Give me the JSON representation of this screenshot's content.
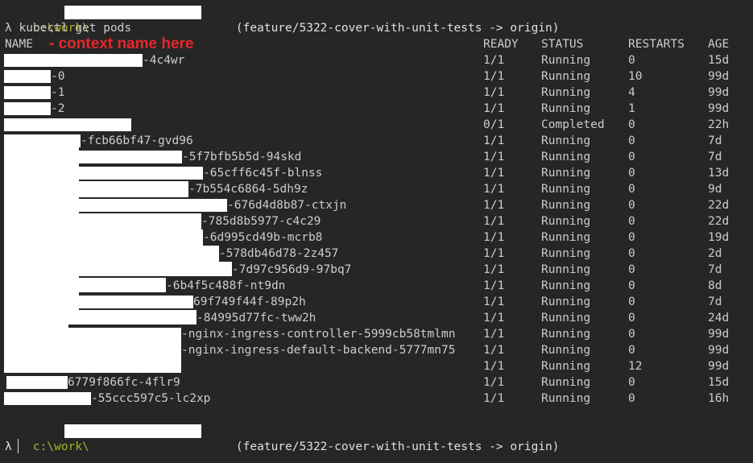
{
  "prompt": {
    "path_prefix": "c:\\work\\",
    "branch_info": "(feature/5322-cover-with-unit-tests -> origin)",
    "lambda": "λ"
  },
  "command": "λ kubectl get pods",
  "annotation": "- context name here",
  "headers": {
    "name": "NAME",
    "ready": "READY",
    "status": "STATUS",
    "restarts": "RESTARTS",
    "age": "AGE"
  },
  "rows": [
    {
      "name_suffix": "-4c4wr",
      "ready": "1/1",
      "status": "Running",
      "restarts": "0",
      "age": "15d"
    },
    {
      "name_suffix": "-0",
      "ready": "1/1",
      "status": "Running",
      "restarts": "10",
      "age": "99d"
    },
    {
      "name_suffix": "-1",
      "ready": "1/1",
      "status": "Running",
      "restarts": "4",
      "age": "99d"
    },
    {
      "name_suffix": "-2",
      "ready": "1/1",
      "status": "Running",
      "restarts": "1",
      "age": "99d"
    },
    {
      "name_suffix": "",
      "ready": "0/1",
      "status": "Completed",
      "restarts": "0",
      "age": "22h"
    },
    {
      "name_suffix": "-fcb66bf47-gvd96",
      "ready": "1/1",
      "status": "Running",
      "restarts": "0",
      "age": "7d"
    },
    {
      "name_suffix": "-5f7bfb5b5d-94skd",
      "ready": "1/1",
      "status": "Running",
      "restarts": "0",
      "age": "7d"
    },
    {
      "name_suffix": "-65cff6c45f-blnss",
      "ready": "1/1",
      "status": "Running",
      "restarts": "0",
      "age": "13d"
    },
    {
      "name_suffix": "-7b554c6864-5dh9z",
      "ready": "1/1",
      "status": "Running",
      "restarts": "0",
      "age": "9d"
    },
    {
      "name_suffix": "-676d4d8b87-ctxjn",
      "ready": "1/1",
      "status": "Running",
      "restarts": "0",
      "age": "22d"
    },
    {
      "name_suffix": "-785d8b5977-c4c29",
      "ready": "1/1",
      "status": "Running",
      "restarts": "0",
      "age": "22d"
    },
    {
      "name_suffix": "-6d995cd49b-mcrb8",
      "ready": "1/1",
      "status": "Running",
      "restarts": "0",
      "age": "19d"
    },
    {
      "name_suffix": "-578db46d78-2z457",
      "ready": "1/1",
      "status": "Running",
      "restarts": "0",
      "age": "2d"
    },
    {
      "name_suffix": "-7d97c956d9-97bq7",
      "ready": "1/1",
      "status": "Running",
      "restarts": "0",
      "age": "7d"
    },
    {
      "name_suffix": "-6b4f5c488f-nt9dn",
      "ready": "1/1",
      "status": "Running",
      "restarts": "0",
      "age": "8d"
    },
    {
      "name_suffix": "69f749f44f-89p2h",
      "ready": "1/1",
      "status": "Running",
      "restarts": "0",
      "age": "7d"
    },
    {
      "name_suffix": "-84995d77fc-tww2h",
      "ready": "1/1",
      "status": "Running",
      "restarts": "0",
      "age": "24d"
    },
    {
      "name_suffix": "-nginx-ingress-controller-5999cb58tmlmn",
      "ready": "1/1",
      "status": "Running",
      "restarts": "0",
      "age": "99d"
    },
    {
      "name_suffix": "-nginx-ingress-default-backend-5777mn75",
      "ready": "1/1",
      "status": "Running",
      "restarts": "0",
      "age": "99d"
    },
    {
      "name_suffix": "",
      "ready": "1/1",
      "status": "Running",
      "restarts": "12",
      "age": "99d"
    },
    {
      "name_suffix": "6779f866fc-4flr9",
      "ready": "1/1",
      "status": "Running",
      "restarts": "0",
      "age": "15d"
    },
    {
      "name_suffix": "-55ccc597c5-lc2xp",
      "ready": "1/1",
      "status": "Running",
      "restarts": "0",
      "age": "16h"
    }
  ],
  "colors": {
    "background": "#262626",
    "text": "#cccccc",
    "prompt_path": "#a8b32e",
    "annotation": "#e8262a",
    "redaction": "#ffffff"
  }
}
